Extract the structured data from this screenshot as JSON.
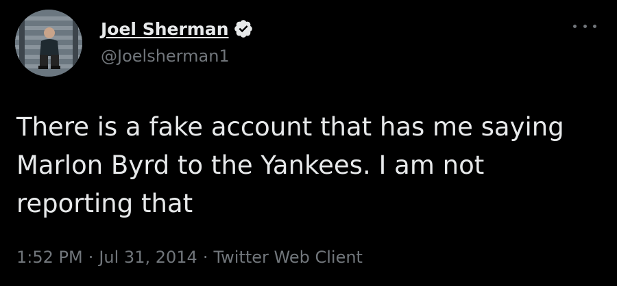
{
  "author": {
    "display_name": "Joel Sherman",
    "handle": "@Joelsherman1",
    "verified": true,
    "avatar_icon": "profile-photo"
  },
  "tweet": {
    "text": "There is a fake account that has me saying Marlon Byrd to the Yankees. I am not reporting that"
  },
  "meta": {
    "time": "1:52 PM",
    "date": "Jul 31, 2014",
    "source": "Twitter Web Client",
    "separator": "·"
  },
  "colors": {
    "background": "#000000",
    "text_primary": "#e7e9ea",
    "text_secondary": "#71767b",
    "verified_badge": "#e7e9ea"
  },
  "icons": {
    "more": "more-options-icon",
    "verified": "verified-badge-icon"
  }
}
